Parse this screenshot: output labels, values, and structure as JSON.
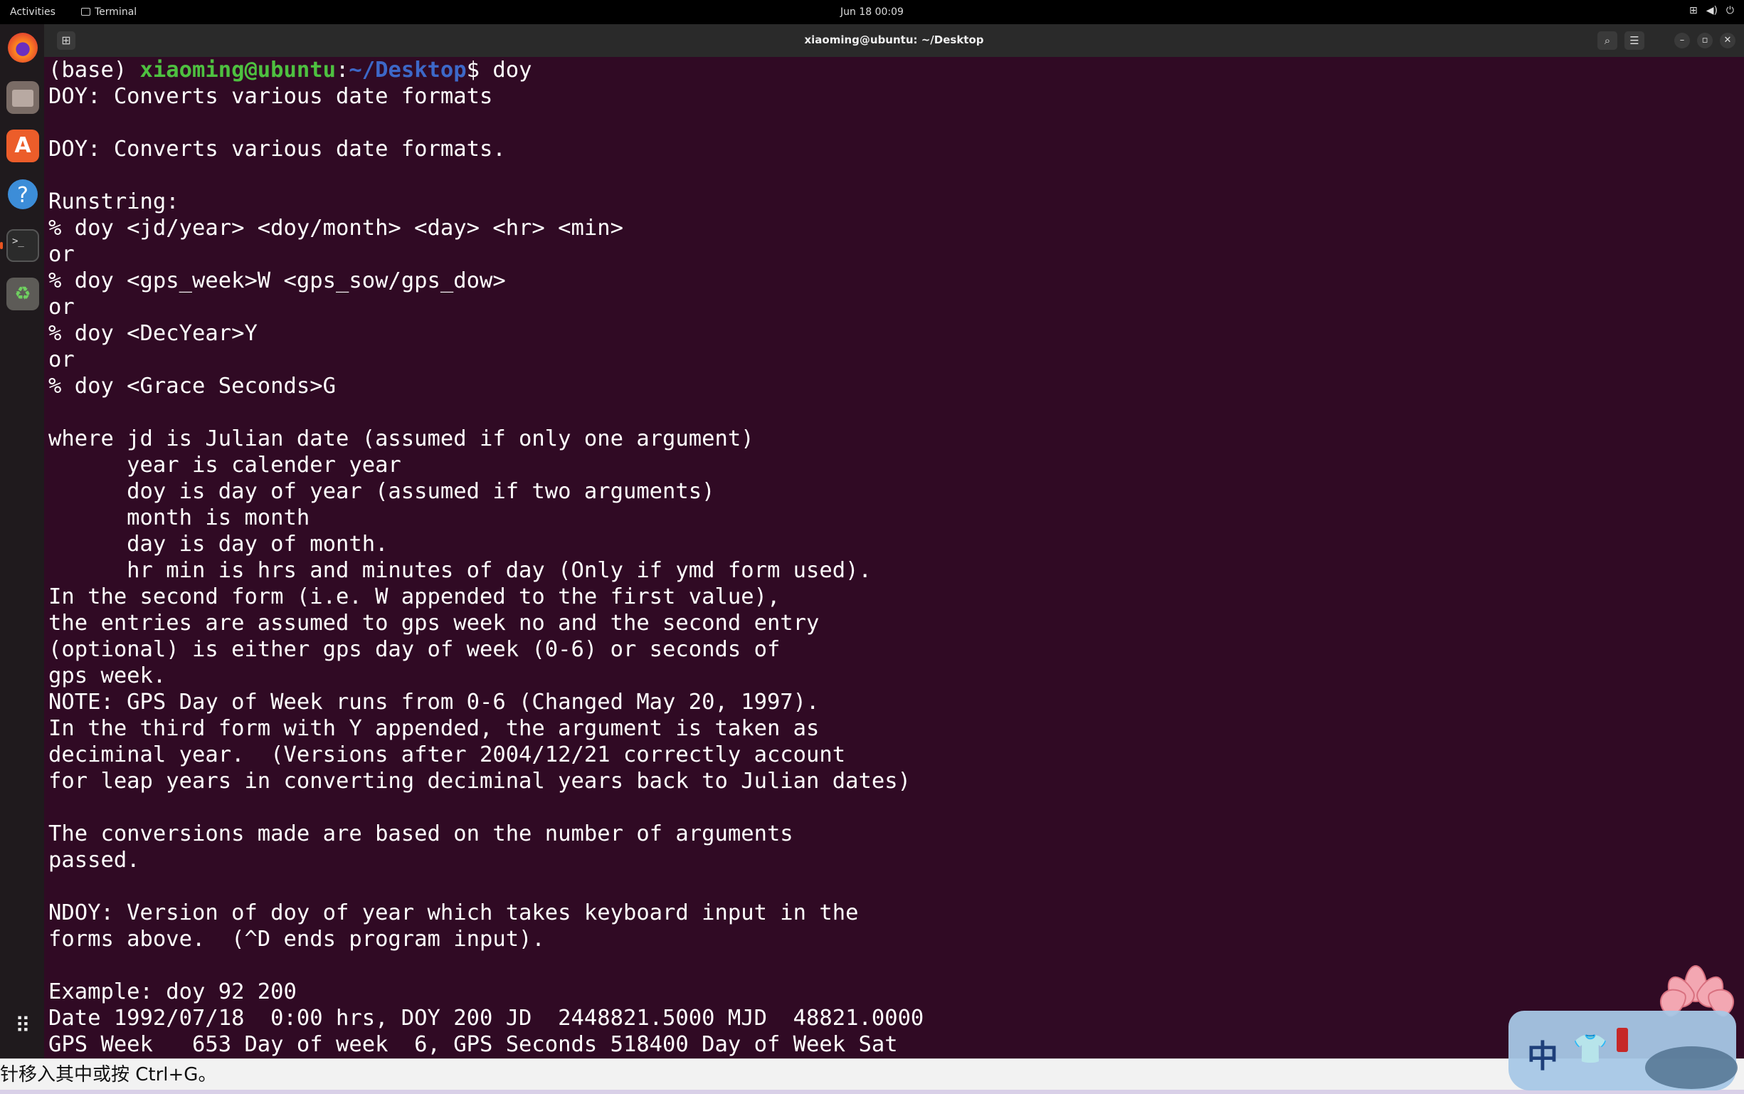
{
  "topbar": {
    "activities": "Activities",
    "taskbar_app": "Terminal",
    "clock": "Jun 18  00:09",
    "status_icons": [
      "network-icon",
      "volume-icon",
      "power-icon"
    ]
  },
  "dock": {
    "items": [
      "firefox-icon",
      "files-icon",
      "app-store-icon",
      "help-icon",
      "terminal-icon",
      "trash-icon"
    ],
    "apps_grid": "show-apps-icon"
  },
  "window": {
    "title": "xiaoming@ubuntu: ~/Desktop",
    "buttons": [
      "search-icon",
      "menu-icon",
      "minimize-icon",
      "maximize-icon",
      "close-icon"
    ]
  },
  "terminal": {
    "prompt": {
      "env": "(base) ",
      "user_host": "xiaoming@ubuntu",
      "sep": ":",
      "path": "~/Desktop",
      "symbol": "$ ",
      "command": "doy"
    },
    "output": "DOY: Converts various date formats\n\nDOY: Converts various date formats.\n\nRunstring:\n% doy <jd/year> <doy/month> <day> <hr> <min>\nor\n% doy <gps_week>W <gps_sow/gps_dow>\nor\n% doy <DecYear>Y\nor\n% doy <Grace Seconds>G\n\nwhere jd is Julian date (assumed if only one argument)\n      year is calender year\n      doy is day of year (assumed if two arguments)\n      month is month\n      day is day of month.\n      hr min is hrs and minutes of day (Only if ymd form used).\nIn the second form (i.e. W appended to the first value),\nthe entries are assumed to gps week no and the second entry\n(optional) is either gps day of week (0-6) or seconds of\ngps week.\nNOTE: GPS Day of Week runs from 0-6 (Changed May 20, 1997).\nIn the third form with Y appended, the argument is taken as\ndeciminal year.  (Versions after 2004/12/21 correctly account\nfor leap years in converting deciminal years back to Julian dates)\n\nThe conversions made are based on the number of arguments\npassed.\n\nNDOY: Version of doy of year which takes keyboard input in the\nforms above.  (^D ends program input).\n\nExample: doy 92 200\nDate 1992/07/18  0:00 hrs, DOY 200 JD  2448821.5000 MJD  48821.0000\nGPS Week   653 Day of week  6, GPS Seconds 518400 Day of Week Sat"
  },
  "statusbar": {
    "text": "针移入其中或按 Ctrl+G。"
  },
  "ime": {
    "mode_label": "中"
  }
}
